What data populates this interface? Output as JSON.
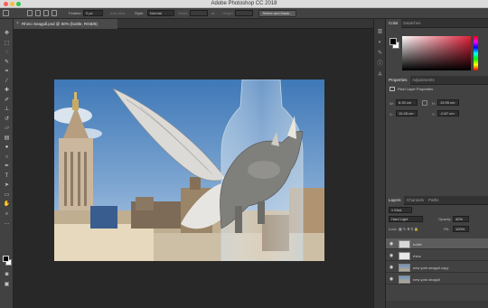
{
  "window": {
    "title": "Adobe Photoshop CC 2018"
  },
  "options_bar": {
    "feather_label": "Feather:",
    "feather_value": "0 px",
    "anti_alias_label": "Anti-alias",
    "style_label": "Style:",
    "style_value": "Normal",
    "width_label": "Width:",
    "height_label": "Height:",
    "select_mask_label": "Select and Mask..."
  },
  "document": {
    "tab_title": "Rhino Seagull.psd @ 50% (bottle, RGB/8)",
    "close_glyph": "×"
  },
  "toolbox": {
    "tools": [
      {
        "name": "move-icon",
        "glyph": "✥"
      },
      {
        "name": "marquee-icon",
        "glyph": "⬚"
      },
      {
        "name": "lasso-icon",
        "glyph": "◌"
      },
      {
        "name": "quick-select-icon",
        "glyph": "✎"
      },
      {
        "name": "crop-icon",
        "glyph": "⌗"
      },
      {
        "name": "eyedropper-icon",
        "glyph": "⁄"
      },
      {
        "name": "healing-brush-icon",
        "glyph": "✚"
      },
      {
        "name": "brush-icon",
        "glyph": "✐"
      },
      {
        "name": "clone-stamp-icon",
        "glyph": "⊥"
      },
      {
        "name": "history-brush-icon",
        "glyph": "↺"
      },
      {
        "name": "eraser-icon",
        "glyph": "▱"
      },
      {
        "name": "gradient-icon",
        "glyph": "▤"
      },
      {
        "name": "blur-icon",
        "glyph": "●"
      },
      {
        "name": "dodge-icon",
        "glyph": "○"
      },
      {
        "name": "pen-icon",
        "glyph": "✒"
      },
      {
        "name": "type-icon",
        "glyph": "T"
      },
      {
        "name": "path-select-icon",
        "glyph": "➤"
      },
      {
        "name": "shape-icon",
        "glyph": "▭"
      },
      {
        "name": "hand-icon",
        "glyph": "✋"
      },
      {
        "name": "zoom-icon",
        "glyph": "⌕"
      },
      {
        "name": "more-tools-icon",
        "glyph": "…"
      }
    ],
    "extra": [
      {
        "name": "quick-mask-icon",
        "glyph": "◙"
      },
      {
        "name": "screen-mode-icon",
        "glyph": "▣"
      }
    ]
  },
  "mid_strip": {
    "icons": [
      {
        "name": "history-panel-icon",
        "glyph": "▥"
      },
      {
        "name": "adjustments-panel-icon",
        "glyph": "◐"
      },
      {
        "name": "brush-panel-icon",
        "glyph": "✎"
      },
      {
        "name": "info-panel-icon",
        "glyph": "ⓘ"
      },
      {
        "name": "character-panel-icon",
        "glyph": "A"
      }
    ]
  },
  "color_panel": {
    "tabs": [
      "Color",
      "Swatches"
    ],
    "active_tab": 0,
    "hue_color": "#e0213a"
  },
  "properties_panel": {
    "tabs": [
      "Properties",
      "Adjustments"
    ],
    "active_tab": 0,
    "title": "Pixel Layer Properties",
    "w_label": "W:",
    "w_value": "6.93 cm",
    "go_label": "GO",
    "h_label": "H:",
    "h_value": "19.95 cm",
    "x_label": "X:",
    "x_value": "15.28 cm",
    "y_label": "Y:",
    "y_value": "-0.67 cm"
  },
  "layers_panel": {
    "tabs": [
      "Layers",
      "Channels",
      "Paths"
    ],
    "active_tab": 0,
    "filter_value": "Kind",
    "blend_mode": "Hard Light",
    "opacity_label": "Opacity:",
    "opacity_value": "40%",
    "lock_label": "Lock:",
    "fill_label": "Fill:",
    "fill_value": "100%",
    "layers": [
      {
        "name": "bottle",
        "selected": true
      },
      {
        "name": "rhino",
        "selected": false
      },
      {
        "name": "new york seagull copy",
        "selected": false
      },
      {
        "name": "new york seagull",
        "selected": false
      }
    ]
  }
}
